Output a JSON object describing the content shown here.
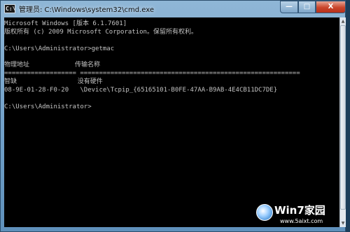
{
  "window": {
    "title": "管理员: C:\\Windows\\system32\\cmd.exe",
    "icon_text": "C:\\",
    "buttons": {
      "minimize": "—",
      "maximize": "□",
      "close": "X"
    }
  },
  "console": {
    "lines": [
      "Microsoft Windows [版本 6.1.7601]",
      "版权所有 (c) 2009 Microsoft Corporation。保留所有权利。",
      "",
      "C:\\Users\\Administrator>getmac",
      "",
      "物理地址            传输名称",
      "=================== ==========================================================",
      "智缺                没有硬件",
      "08-9E-01-28-F0-20   \\Device\\Tcpip_{65165101-B0FE-47AA-B9AB-4E4CB11DC7DE}",
      "",
      "C:\\Users\\Administrator>"
    ]
  },
  "scrollbar": {
    "up_glyph": "▲",
    "down_glyph": "▼"
  },
  "watermark": {
    "brand": "Win7家园",
    "url": "www.5aixt.com"
  }
}
